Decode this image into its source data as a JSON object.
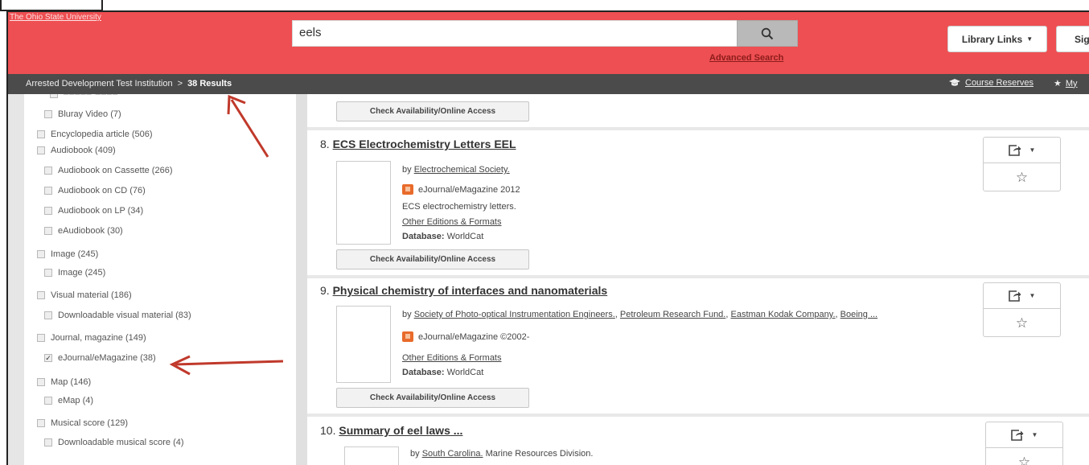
{
  "header": {
    "institution_link": "The Ohio State University",
    "search_value": "eels",
    "advanced_search": "Advanced Search",
    "library_links": "Library Links",
    "sign_in": "Sig"
  },
  "breadcrumb": {
    "institution": "Arrested Development Test Institution",
    "separator": ">",
    "results": "38 Results",
    "course_reserves": "Course Reserves",
    "my": "My"
  },
  "facets": [
    {
      "label": "Bluray Video (7)",
      "checked": false,
      "indent": true
    },
    {
      "label": "Encyclopedia article (506)",
      "checked": false,
      "indent": false
    },
    {
      "label": "Audiobook (409)",
      "checked": false,
      "indent": false
    },
    {
      "label": "Audiobook on Cassette (266)",
      "checked": false,
      "indent": true
    },
    {
      "label": "Audiobook on CD (76)",
      "checked": false,
      "indent": true
    },
    {
      "label": "Audiobook on LP (34)",
      "checked": false,
      "indent": true
    },
    {
      "label": "eAudiobook (30)",
      "checked": false,
      "indent": true
    },
    {
      "label": "Image (245)",
      "checked": false,
      "indent": false
    },
    {
      "label": "Image (245)",
      "checked": false,
      "indent": true
    },
    {
      "label": "Visual material (186)",
      "checked": false,
      "indent": false
    },
    {
      "label": "Downloadable visual material (83)",
      "checked": false,
      "indent": true
    },
    {
      "label": "Journal, magazine (149)",
      "checked": false,
      "indent": false
    },
    {
      "label": "eJournal/eMagazine (38)",
      "checked": true,
      "indent": true
    },
    {
      "label": "Map (146)",
      "checked": false,
      "indent": false
    },
    {
      "label": "eMap (4)",
      "checked": false,
      "indent": true
    },
    {
      "label": "Musical score (129)",
      "checked": false,
      "indent": false
    },
    {
      "label": "Downloadable musical score (4)",
      "checked": false,
      "indent": true
    }
  ],
  "results": {
    "check_availability": "Check Availability/Online Access",
    "items": [
      {
        "number": "8.",
        "title": "ECS Electrochemistry Letters EEL",
        "by_prefix": "by",
        "authors": "Electrochemical Society.",
        "format": "eJournal/eMagazine 2012",
        "description": "ECS electrochemistry letters.",
        "other_editions": "Other Editions & Formats",
        "database_label": "Database:",
        "database": "WorldCat"
      },
      {
        "number": "9.",
        "title": "Physical chemistry of interfaces and nanomaterials",
        "by_prefix": "by",
        "authors": [
          "Society of Photo-optical Instrumentation Engineers.",
          "Petroleum Research Fund.",
          "Eastman Kodak Company.",
          "Boeing ..."
        ],
        "format": "eJournal/eMagazine ©2002-",
        "other_editions": "Other Editions & Formats",
        "database_label": "Database:",
        "database": "WorldCat"
      },
      {
        "number": "10.",
        "title": "Summary of eel laws ...",
        "by_prefix": "by",
        "authors": "South Carolina.",
        "authors_rest": "Marine Resources Division."
      }
    ]
  },
  "colors": {
    "banner": "#ee4f52",
    "crumbbar": "#4b4b4b",
    "arrow": "#c0392b"
  },
  "icons": {
    "search": "search-icon",
    "share": "share-icon",
    "favorite": "star-icon"
  }
}
